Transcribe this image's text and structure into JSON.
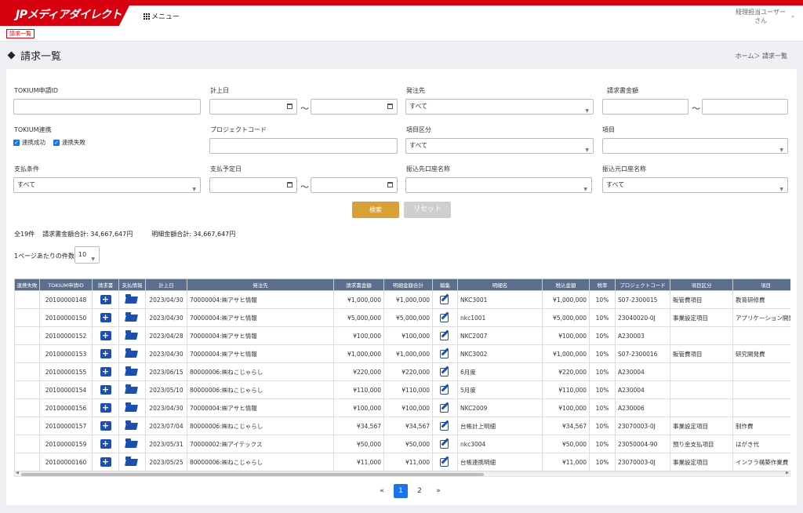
{
  "app": {
    "logo_text": "JPメディアダイレクト",
    "menu_label": "メニュー",
    "user_line1": "経理担当ユーザー",
    "user_line2": "さん"
  },
  "subbar": {
    "tag": "請求一覧"
  },
  "page": {
    "title": "請求一覧",
    "breadcrumb": "ホーム＞ 請求一覧"
  },
  "filters": {
    "tokium_id": {
      "label": "TOKIUM申請ID",
      "value": ""
    },
    "keijo_date": {
      "label": "計上日"
    },
    "hacchusaki": {
      "label": "発注先",
      "value": "すべて"
    },
    "seikyu_amount": {
      "label": "請求書金額"
    },
    "tokium_renkei": {
      "label": "TOKIUM連携",
      "opt1": "連携成功",
      "opt2": "連携失敗"
    },
    "project_code": {
      "label": "プロジェクトコード"
    },
    "koumoku_kubun": {
      "label": "項目区分",
      "value": "すべて"
    },
    "koumoku": {
      "label": "項目",
      "value": ""
    },
    "shiharai_jouken": {
      "label": "支払条件",
      "value": "すべて"
    },
    "shiharai_yotei": {
      "label": "支払予定日"
    },
    "furikomisaki": {
      "label": "振込先口座名称",
      "value": ""
    },
    "furikomimoto": {
      "label": "振込元口座名称",
      "value": "すべて"
    },
    "tilde": "～"
  },
  "buttons": {
    "search": "検索",
    "reset": "リセット"
  },
  "summary": {
    "count": "全19件",
    "seikyu_total": "請求書金額合計: 34,667,647円",
    "meisai_total": "明細金額合計: 34,667,647円"
  },
  "perpage": {
    "label": "1ページあたりの件数",
    "value": "10"
  },
  "table": {
    "headers": [
      "連携失敗",
      "TOKIUM申請ID",
      "請求書",
      "支払情報",
      "計上日",
      "発注先",
      "請求書金額",
      "明細金額合計",
      "編集",
      "明細名",
      "税込金額",
      "税率",
      "プロジェクトコード",
      "項目区分",
      "項目"
    ],
    "rows": [
      [
        "",
        "20100000148",
        "2023/04/30",
        "70000004:㈱アサヒ情報",
        "¥1,000,000",
        "¥1,000,000",
        "NKC3001",
        "¥1,000,000",
        "10%",
        "S07-2300015",
        "販管費項目",
        "教育研修費"
      ],
      [
        "",
        "20100000150",
        "2023/04/30",
        "70000004:㈱アサヒ情報",
        "¥5,000,000",
        "¥5,000,000",
        "nkc1001",
        "¥5,000,000",
        "10%",
        "23040020-0J",
        "事業設定項目",
        "アプリケーション開発費"
      ],
      [
        "",
        "20100000152",
        "2023/04/28",
        "70000004:㈱アサヒ情報",
        "¥100,000",
        "¥100,000",
        "NKC2007",
        "¥100,000",
        "10%",
        "A230003",
        "",
        ""
      ],
      [
        "",
        "20100000153",
        "2023/04/30",
        "70000004:㈱アサヒ情報",
        "¥1,000,000",
        "¥1,000,000",
        "NKC3002",
        "¥1,000,000",
        "10%",
        "S07-2300016",
        "販管費項目",
        "研究開発費"
      ],
      [
        "",
        "20100000155",
        "2023/06/15",
        "80000006:㈱ねこじゃらし",
        "¥220,000",
        "¥220,000",
        "6月度",
        "¥220,000",
        "10%",
        "A230004",
        "",
        ""
      ],
      [
        "",
        "20100000154",
        "2023/05/10",
        "80000006:㈱ねこじゃらし",
        "¥110,000",
        "¥110,000",
        "5月度",
        "¥110,000",
        "10%",
        "A230004",
        "",
        ""
      ],
      [
        "",
        "20100000156",
        "2023/04/30",
        "70000004:㈱アサヒ情報",
        "¥100,000",
        "¥100,000",
        "NKC2009",
        "¥100,000",
        "10%",
        "A230006",
        "",
        ""
      ],
      [
        "",
        "20100000157",
        "2023/07/04",
        "80000006:㈱ねこじゃらし",
        "¥34,567",
        "¥34,567",
        "台帳計上明細",
        "¥34,567",
        "10%",
        "23070003-0J",
        "事業設定項目",
        "制作費"
      ],
      [
        "",
        "20100000159",
        "2023/05/31",
        "70000002:㈱アイテックス",
        "¥50,000",
        "¥50,000",
        "nkc3004",
        "¥50,000",
        "10%",
        "23050004-90",
        "預り金支払項目",
        "はがき代"
      ],
      [
        "",
        "20100000160",
        "2023/05/25",
        "80000006:㈱ねこじゃらし",
        "¥11,000",
        "¥11,000",
        "台帳連携明細",
        "¥11,000",
        "10%",
        "23070003-0J",
        "事業設定項目",
        "インフラ構築作業費"
      ]
    ]
  },
  "pagination": {
    "prev": "«",
    "page1": "1",
    "page2": "2",
    "next": "»"
  },
  "colors": {
    "brand_red": "#d7000f",
    "header_navy": "#5b6f8c",
    "icon_blue": "#1d4fae",
    "search_gold": "#d9a036"
  }
}
